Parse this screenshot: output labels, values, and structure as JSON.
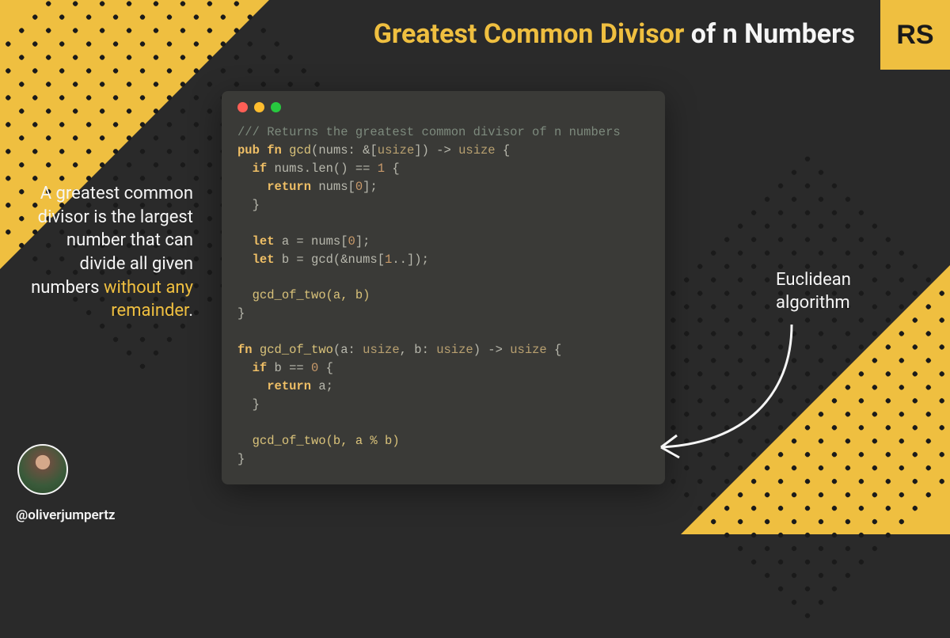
{
  "title": {
    "accent": "Greatest Common Divisor",
    "rest": " of n Numbers"
  },
  "badge": "RS",
  "description": {
    "lead": "A greatest common divisor is the largest number that can divide all given numbers ",
    "accent": "without any remainder",
    "tail": "."
  },
  "annotation": "Euclidean algorithm",
  "handle": "@oliverjumpertz",
  "code": {
    "comment": "/// Returns the greatest common divisor of n numbers",
    "l2_pub": "pub",
    "l2_fn": "fn",
    "l2_name": "gcd",
    "l2_sig_a": "(nums: &[",
    "l2_ty": "usize",
    "l2_sig_b": "]) -> ",
    "l2_ty2": "usize",
    "l2_brace": " {",
    "l3_if": "if",
    "l3_rest": " nums.len() == ",
    "l3_num": "1",
    "l3_brace": " {",
    "l4_ret": "return",
    "l4_rest": " nums[",
    "l4_num": "0",
    "l4_end": "];",
    "l5_close": "}",
    "l7_let": "let",
    "l7_a": " a = nums[",
    "l7_num": "0",
    "l7_end": "];",
    "l8_let": "let",
    "l8_b": " b = gcd(&nums[",
    "l8_num": "1",
    "l8_end": "..]);",
    "l10_call": "gcd_of_two(a, b)",
    "l11_close": "}",
    "l13_fn": "fn",
    "l13_name": "gcd_of_two",
    "l13_sig_a": "(a: ",
    "l13_ty1": "usize",
    "l13_mid": ", b: ",
    "l13_ty2": "usize",
    "l13_sig_b": ") -> ",
    "l13_ty3": "usize",
    "l13_brace": " {",
    "l14_if": "if",
    "l14_rest": " b == ",
    "l14_num": "0",
    "l14_brace": " {",
    "l15_ret": "return",
    "l15_rest": " a;",
    "l16_close": "}",
    "l18_call": "gcd_of_two(b, a % b)",
    "l19_close": "}"
  }
}
